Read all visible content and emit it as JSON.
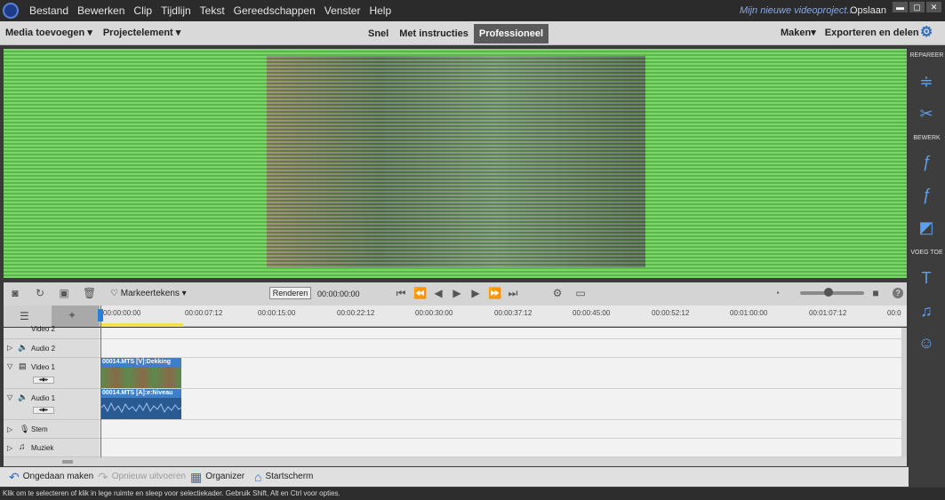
{
  "menu": {
    "items": [
      "Bestand",
      "Bewerken",
      "Clip",
      "Tijdlijn",
      "Tekst",
      "Gereedschappen",
      "Venster",
      "Help"
    ],
    "project_name": "Mijn nieuwe videoproject....",
    "save_label": "Opslaan"
  },
  "toolbar": {
    "media_add": "Media toevoegen",
    "project_element": "Projectelement",
    "modes": [
      "Snel",
      "Met instructies",
      "Professioneel"
    ],
    "make": "Maken",
    "export_share": "Exporteren en delen"
  },
  "right_panel": {
    "repair": "REPAREER",
    "edit": "BEWERK",
    "add": "VOEG TOE"
  },
  "controls": {
    "markers": "Markeertekens",
    "render": "Renderen",
    "timecode": "00:00:00:00"
  },
  "ruler": {
    "ticks": [
      "00:00:00:00",
      "00:00:07:12",
      "00:00:15:00",
      "00:00:22:12",
      "00:00:30:00",
      "00:00:37:12",
      "00:00:45:00",
      "00:00:52:12",
      "00:01:00:00",
      "00:01:07:12",
      "00:0"
    ]
  },
  "tracks": {
    "video2": "Video 2",
    "audio2": "Audio 2",
    "video1": "Video 1",
    "audio1": "Audio 1",
    "voice": "Stem",
    "music": "Muziek",
    "video_clip": "00014.MTS [V]:Dekking",
    "audio_clip": "00014.MTS [A]:e:Niveau"
  },
  "bottom": {
    "undo": "Ongedaan maken",
    "redo": "Opnieuw uitvoeren",
    "organizer": "Organizer",
    "home": "Startscherm"
  },
  "status": "Klik om te selecteren of klik in lege ruimte en sleep voor selectiekader. Gebruik Shift, Alt en Ctrl voor opties."
}
